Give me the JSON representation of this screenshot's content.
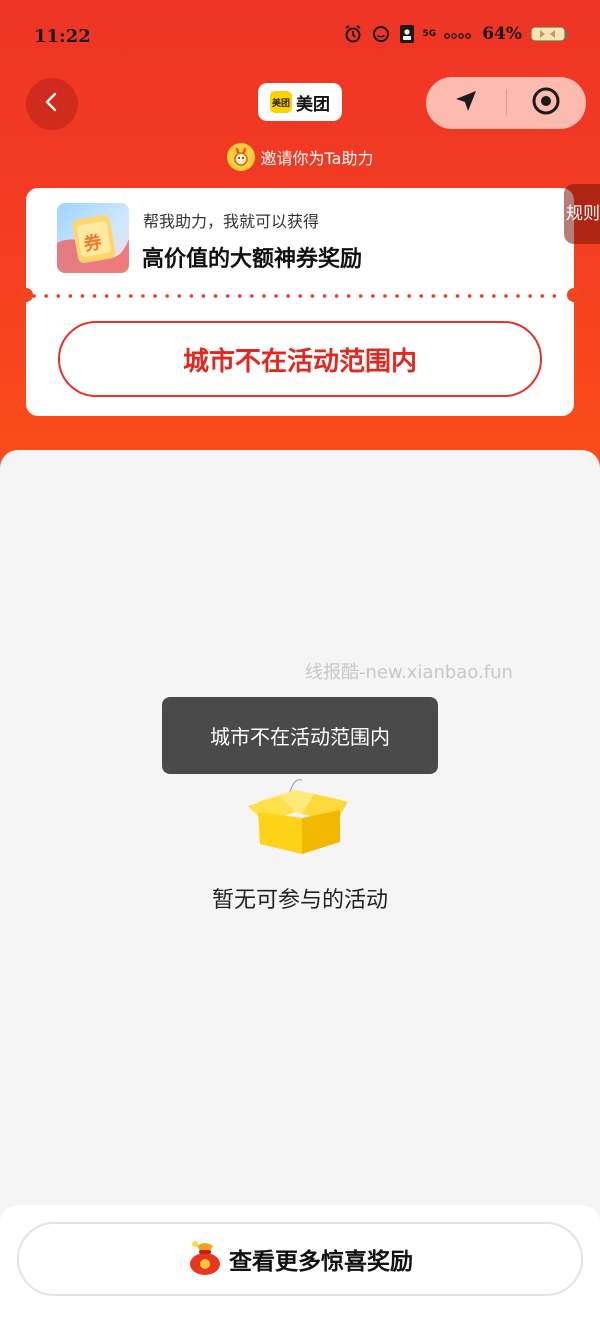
{
  "status_bar": {
    "time": "11:22",
    "network": "5G",
    "battery": "64%"
  },
  "header": {
    "logo_badge": "美团",
    "logo_text": "美团",
    "invite_text": "邀请你为Ta助力",
    "rules_label": "规则"
  },
  "card": {
    "subtitle": "帮我助力，我就可以获得",
    "title": "高价值的大额神券奖励",
    "coupon_glyph": "券",
    "status_button": "城市不在活动范围内"
  },
  "main": {
    "watermark": "线报酷-new.xianbao.fun",
    "toast": "城市不在活动范围内",
    "empty_text": "暂无可参与的活动"
  },
  "bottom": {
    "button_label": "查看更多惊喜奖励"
  },
  "colors": {
    "brand_red": "#ee3526",
    "accent_red": "#e3271f",
    "meituan_yellow": "#ffd100"
  },
  "icons": [
    "alarm-icon",
    "face-icon",
    "sim-icon",
    "battery-icon",
    "back-icon",
    "location-arrow-icon",
    "target-icon",
    "lucky-bag-icon",
    "empty-box-icon"
  ]
}
